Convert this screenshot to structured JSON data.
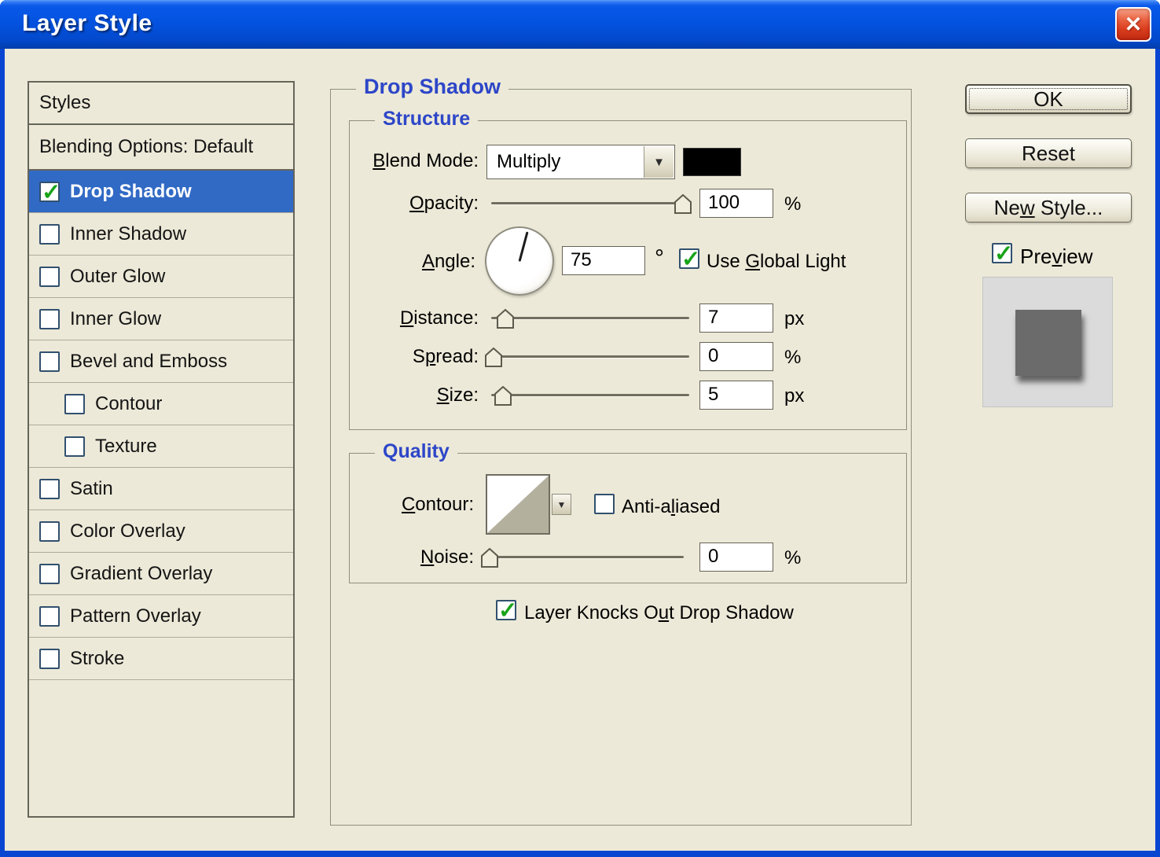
{
  "window": {
    "title": "Layer Style"
  },
  "icons": {
    "close": "✕",
    "dropdown": "▼"
  },
  "sidebar": {
    "header": "Styles",
    "items": [
      {
        "label": "Blending Options: Default",
        "has_checkbox": false,
        "checked": false,
        "selected": false,
        "indented": false
      },
      {
        "label": "Drop Shadow",
        "has_checkbox": true,
        "checked": true,
        "selected": true,
        "indented": false
      },
      {
        "label": "Inner Shadow",
        "has_checkbox": true,
        "checked": false,
        "selected": false,
        "indented": false
      },
      {
        "label": "Outer Glow",
        "has_checkbox": true,
        "checked": false,
        "selected": false,
        "indented": false
      },
      {
        "label": "Inner Glow",
        "has_checkbox": true,
        "checked": false,
        "selected": false,
        "indented": false
      },
      {
        "label": "Bevel and Emboss",
        "has_checkbox": true,
        "checked": false,
        "selected": false,
        "indented": false
      },
      {
        "label": "Contour",
        "has_checkbox": true,
        "checked": false,
        "selected": false,
        "indented": true
      },
      {
        "label": "Texture",
        "has_checkbox": true,
        "checked": false,
        "selected": false,
        "indented": true
      },
      {
        "label": "Satin",
        "has_checkbox": true,
        "checked": false,
        "selected": false,
        "indented": false
      },
      {
        "label": "Color Overlay",
        "has_checkbox": true,
        "checked": false,
        "selected": false,
        "indented": false
      },
      {
        "label": "Gradient Overlay",
        "has_checkbox": true,
        "checked": false,
        "selected": false,
        "indented": false
      },
      {
        "label": "Pattern Overlay",
        "has_checkbox": true,
        "checked": false,
        "selected": false,
        "indented": false
      },
      {
        "label": "Stroke",
        "has_checkbox": true,
        "checked": false,
        "selected": false,
        "indented": false
      }
    ]
  },
  "panel": {
    "title": "Drop Shadow",
    "structure": {
      "legend": "Structure",
      "blend_mode": {
        "label": "&Blend Mode:",
        "value": "Multiply",
        "color": "#000000"
      },
      "opacity": {
        "label": "&Opacity:",
        "value": "100",
        "unit": "%",
        "percent": 97
      },
      "angle": {
        "label": "&Angle:",
        "value": "75",
        "unit": "°",
        "degrees": 75
      },
      "use_global_light": {
        "label": "Use &Global Light",
        "checked": true
      },
      "distance": {
        "label": "&Distance:",
        "value": "7",
        "unit": "px",
        "percent": 7
      },
      "spread": {
        "label": "S&pread:",
        "value": "0",
        "unit": "%",
        "percent": 1
      },
      "size": {
        "label": "&Size:",
        "value": "5",
        "unit": "px",
        "percent": 6
      }
    },
    "quality": {
      "legend": "Quality",
      "contour": {
        "label": "&Contour:"
      },
      "anti_aliased": {
        "label": "Anti-a&liased",
        "checked": false
      },
      "noise": {
        "label": "&Noise:",
        "value": "0",
        "unit": "%",
        "percent": 2
      }
    },
    "knockout": {
      "label": "Layer Knocks O&ut Drop Shadow",
      "checked": true
    }
  },
  "buttons": {
    "ok": "OK",
    "reset": "Reset",
    "new_style": "Ne&w Style..."
  },
  "preview": {
    "label": "Pre&view",
    "checked": true
  },
  "colors": {
    "selection": "#316AC5",
    "heading": "#2D46C8",
    "check_green": "#18A318",
    "titlebar_blue": "#0353E0",
    "dialog_bg": "#ECE9D8"
  }
}
